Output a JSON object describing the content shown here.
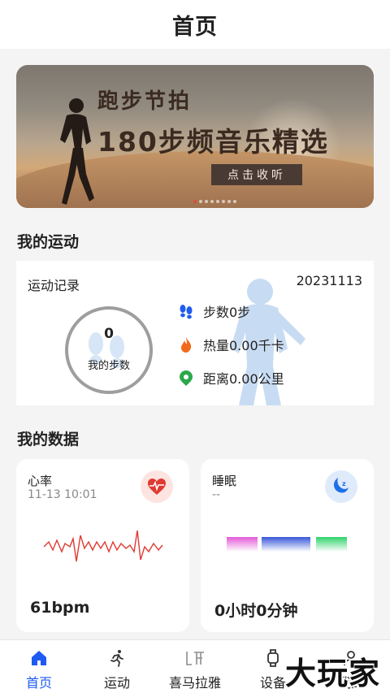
{
  "header": {
    "title": "首页"
  },
  "banner": {
    "line1": "跑步节拍",
    "line2": "180步频音乐精选",
    "button": "点击收听",
    "dots": 8,
    "active_dot": 0
  },
  "sport": {
    "section_title": "我的运动",
    "record_label": "运动记录",
    "date": "20231113",
    "steps_value": "0",
    "steps_caption": "我的步数",
    "stats": [
      {
        "icon": "footprints-icon",
        "text": "步数0步",
        "color": "#1e5bf0"
      },
      {
        "icon": "flame-icon",
        "text": "热量0.00千卡",
        "color": "#f26b1d"
      },
      {
        "icon": "location-pin-icon",
        "text": "距离0.00公里",
        "color": "#2aa84a"
      }
    ]
  },
  "data": {
    "section_title": "我的数据",
    "heart": {
      "title": "心率",
      "time": "11-13 10:01",
      "value": "61bpm",
      "icon": "heart-rate-icon",
      "color": "#e03a32"
    },
    "sleep": {
      "title": "睡眠",
      "time": "--",
      "value": "0小时0分钟",
      "icon": "moon-sleep-icon",
      "color": "#1e6fe8"
    }
  },
  "tabs": [
    {
      "label": "首页",
      "icon": "home-icon",
      "active": true
    },
    {
      "label": "运动",
      "icon": "running-icon",
      "active": false
    },
    {
      "label": "喜马拉雅",
      "icon": "ximalaya-icon",
      "active": false
    },
    {
      "label": "设备",
      "icon": "watch-icon",
      "active": false
    },
    {
      "label": "我的",
      "icon": "profile-icon",
      "active": false
    }
  ],
  "watermark": "大玩家",
  "colors": {
    "accent": "#1e5bf0",
    "background": "#f4f4f4"
  }
}
